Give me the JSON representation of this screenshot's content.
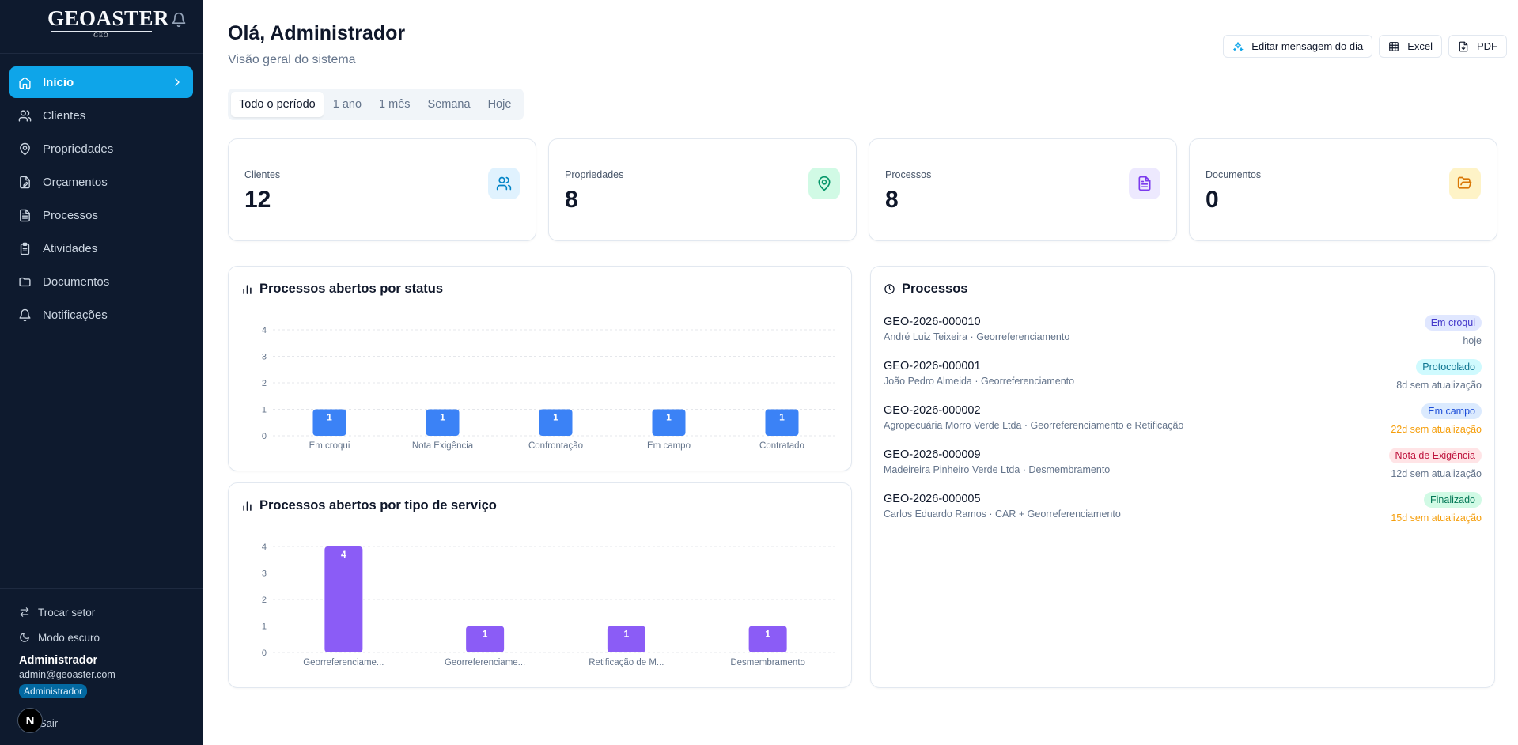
{
  "brand": {
    "logo_main": "GEOASTER",
    "logo_sub": "GEO"
  },
  "nav": [
    {
      "label": "Início",
      "icon": "home-icon"
    },
    {
      "label": "Clientes",
      "icon": "users-icon"
    },
    {
      "label": "Propriedades",
      "icon": "map-pin-icon"
    },
    {
      "label": "Orçamentos",
      "icon": "file-edit-icon"
    },
    {
      "label": "Processos",
      "icon": "file-text-icon"
    },
    {
      "label": "Atividades",
      "icon": "clipboard-icon"
    },
    {
      "label": "Documentos",
      "icon": "folder-icon"
    },
    {
      "label": "Notificações",
      "icon": "bell-icon"
    }
  ],
  "footer": {
    "switch_sector": "Trocar setor",
    "dark_mode": "Modo escuro",
    "user_name": "Administrador",
    "user_email": "admin@geoaster.com",
    "user_role": "Administrador",
    "logout": "Sair",
    "n_badge": "N"
  },
  "header": {
    "title": "Olá, Administrador",
    "subtitle": "Visão geral do sistema",
    "actions": {
      "edit_message": "Editar mensagem do dia",
      "excel": "Excel",
      "pdf": "PDF"
    }
  },
  "period_tabs": [
    "Todo o período",
    "1 ano",
    "1 mês",
    "Semana",
    "Hoje"
  ],
  "stats": [
    {
      "label": "Clientes",
      "value": "12",
      "color": "#0284c7",
      "bg": "#e0f2fe"
    },
    {
      "label": "Propriedades",
      "value": "8",
      "color": "#059669",
      "bg": "#d1fae5"
    },
    {
      "label": "Processos",
      "value": "8",
      "color": "#7c3aed",
      "bg": "#ede9fe"
    },
    {
      "label": "Documentos",
      "value": "0",
      "color": "#d97706",
      "bg": "#fef3c7"
    }
  ],
  "chart_status_title": "Processos abertos por status",
  "chart_service_title": "Processos abertos por tipo de serviço",
  "chart_data": [
    {
      "type": "bar",
      "title": "Processos abertos por status",
      "categories": [
        "Em croqui",
        "Nota Exigência",
        "Confrontação",
        "Em campo",
        "Contratado"
      ],
      "values": [
        1,
        1,
        1,
        1,
        1
      ],
      "ylim": [
        0,
        4
      ],
      "yticks": [
        0,
        1,
        2,
        3,
        4
      ],
      "color": "#3b82f6",
      "grid": true
    },
    {
      "type": "bar",
      "title": "Processos abertos por tipo de serviço",
      "categories": [
        "Georreferenciame...",
        "Georreferenciame...",
        "Retificação de M...",
        "Desmembramento"
      ],
      "values": [
        4,
        1,
        1,
        1
      ],
      "ylim": [
        0,
        4
      ],
      "yticks": [
        0,
        1,
        2,
        3,
        4
      ],
      "color": "#8b5cf6",
      "grid": true
    }
  ],
  "processes_title": "Processos",
  "processes": [
    {
      "code": "GEO-2026-000010",
      "desc": "André Luiz Teixeira · Georreferenciamento",
      "status": "Em croqui",
      "status_color": "#4338ca",
      "status_bg": "#e0e7ff",
      "time": "hoje",
      "time_color": "#64748b"
    },
    {
      "code": "GEO-2026-000001",
      "desc": "João Pedro Almeida · Georreferenciamento",
      "status": "Protocolado",
      "status_color": "#0e7490",
      "status_bg": "#cffafe",
      "time": "8d sem atualização",
      "time_color": "#64748b"
    },
    {
      "code": "GEO-2026-000002",
      "desc": "Agropecuária Morro Verde Ltda · Georreferenciamento e Retificação",
      "status": "Em campo",
      "status_color": "#1d4ed8",
      "status_bg": "#dbeafe",
      "time": "22d sem atualização",
      "time_color": "#f59e0b"
    },
    {
      "code": "GEO-2026-000009",
      "desc": "Madeireira Pinheiro Verde Ltda · Desmembramento",
      "status": "Nota de Exigência",
      "status_color": "#be123c",
      "status_bg": "#ffe4e6",
      "time": "12d sem atualização",
      "time_color": "#64748b"
    },
    {
      "code": "GEO-2026-000005",
      "desc": "Carlos Eduardo Ramos · CAR + Georreferenciamento",
      "status": "Finalizado",
      "status_color": "#047857",
      "status_bg": "#d1fae5",
      "time": "15d sem atualização",
      "time_color": "#f59e0b"
    }
  ]
}
